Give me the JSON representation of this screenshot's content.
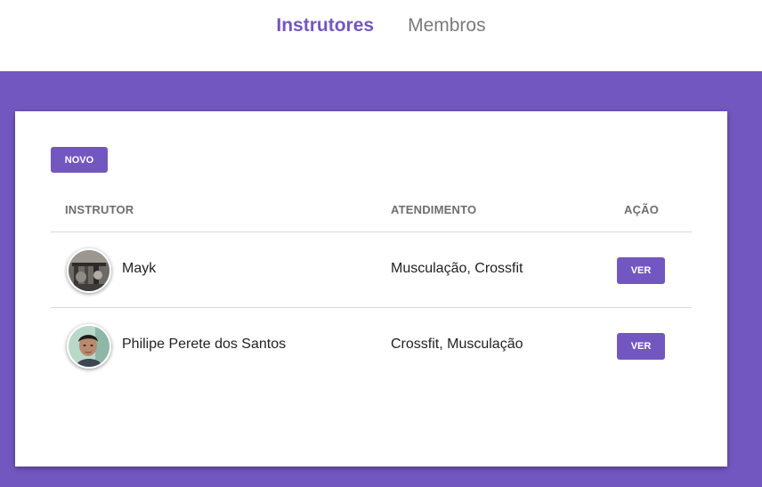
{
  "nav": {
    "items": [
      {
        "label": "Instrutores",
        "active": true
      },
      {
        "label": "Membros",
        "active": false
      }
    ]
  },
  "colors": {
    "accent": "#7357c0",
    "background": "#7357c0",
    "card": "#ffffff",
    "header_text": "#6e6e6e",
    "inactive_nav": "#7a7a7a"
  },
  "toolbar": {
    "new_label": "NOVO"
  },
  "table": {
    "headers": {
      "instructor": "INSTRUTOR",
      "service": "ATENDIMENTO",
      "action": "AÇÃO"
    },
    "rows": [
      {
        "avatar_icon": "gym-photo-avatar",
        "name": "Mayk",
        "services": "Musculação, Crossfit",
        "action_label": "VER"
      },
      {
        "avatar_icon": "person-photo-avatar",
        "name": "Philipe Perete dos Santos",
        "services": "Crossfit, Musculação",
        "action_label": "VER"
      }
    ]
  }
}
